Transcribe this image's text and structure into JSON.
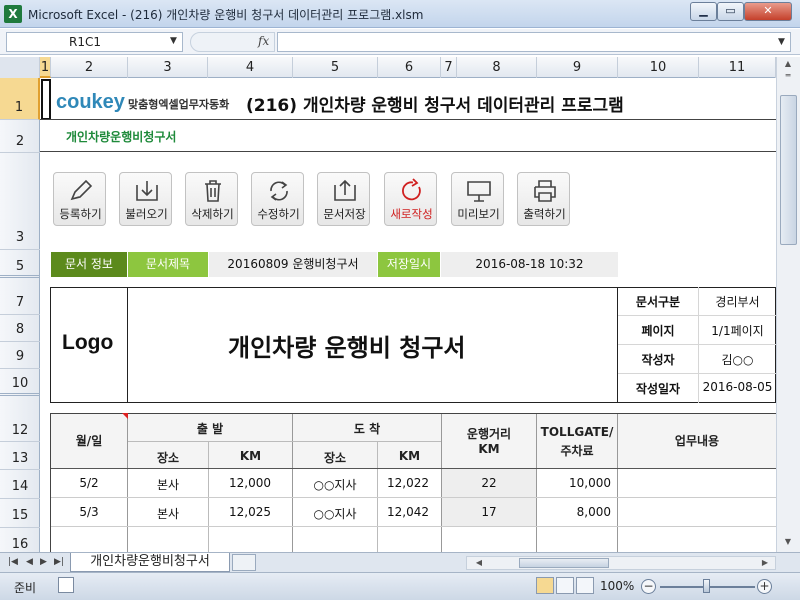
{
  "window": {
    "title": "Microsoft Excel - (216) 개인차량 운행비 청구서 데이터관리 프로그램.xlsm",
    "app_icon": "X"
  },
  "formula_bar": {
    "name_box": "R1C1",
    "fx": "fx",
    "content": ""
  },
  "columns": [
    "1",
    "2",
    "3",
    "4",
    "5",
    "6",
    "7",
    "8",
    "9",
    "10",
    "11"
  ],
  "rows": [
    "1",
    "2",
    "3",
    "5",
    "7",
    "8",
    "9",
    "10",
    "12",
    "13",
    "14",
    "15",
    "16"
  ],
  "header": {
    "logo_text": "coukey",
    "logo_tagline": "맞춤형엑셀업무자동화",
    "title": "(216) 개인차량 운행비 청구서 데이터관리 프로그램",
    "subtitle": "개인차량운행비청구서"
  },
  "toolbar": {
    "buttons": [
      {
        "label": "등록하기",
        "icon": "pencil-icon"
      },
      {
        "label": "불러오기",
        "icon": "download-icon"
      },
      {
        "label": "삭제하기",
        "icon": "trash-icon"
      },
      {
        "label": "수정하기",
        "icon": "refresh-icon"
      },
      {
        "label": "문서저장",
        "icon": "upload-icon"
      },
      {
        "label": "새로작성",
        "icon": "new-doc-icon",
        "color": "#d02020"
      },
      {
        "label": "미리보기",
        "icon": "monitor-icon"
      },
      {
        "label": "출력하기",
        "icon": "printer-icon"
      }
    ]
  },
  "doc_info": {
    "section_label": "문서 정보",
    "title_label": "문서제목",
    "title_value": "20160809 운행비청구서",
    "saved_label": "저장일시",
    "saved_value": "2016-08-18 10:32"
  },
  "document": {
    "logo": "Logo",
    "title": "개인차량 운행비 청구서",
    "info": [
      {
        "label": "문서구분",
        "value": "경리부서"
      },
      {
        "label": "페이지",
        "value": "1/1페이지"
      },
      {
        "label": "작성자",
        "value": "김○○"
      },
      {
        "label": "작성일자",
        "value": "2016-08-05"
      }
    ]
  },
  "table": {
    "headers": {
      "date": "월/일",
      "depart": "출  발",
      "arrive": "도  착",
      "place": "장소",
      "km": "KM",
      "distance_line1": "운행거리",
      "distance_line2": "KM",
      "toll_line1": "TOLLGATE/",
      "toll_line2": "주차료",
      "work": "업무내용"
    },
    "rows": [
      {
        "date": "5/2",
        "dep_place": "본사",
        "dep_km": "12,000",
        "arr_place": "○○지사",
        "arr_km": "12,022",
        "distance": "22",
        "toll": "10,000",
        "work": ""
      },
      {
        "date": "5/3",
        "dep_place": "본사",
        "dep_km": "12,025",
        "arr_place": "○○지사",
        "arr_km": "12,042",
        "distance": "17",
        "toll": "8,000",
        "work": ""
      }
    ]
  },
  "sheet_tabs": {
    "active": "개인차량운행비청구서"
  },
  "status": {
    "mode": "준비",
    "zoom": "100%"
  },
  "colors": {
    "accent_dark": "#5c8a1c",
    "accent_light": "#8dc63f",
    "brand": "#2f88b8",
    "green_text": "#1e8a3a"
  }
}
